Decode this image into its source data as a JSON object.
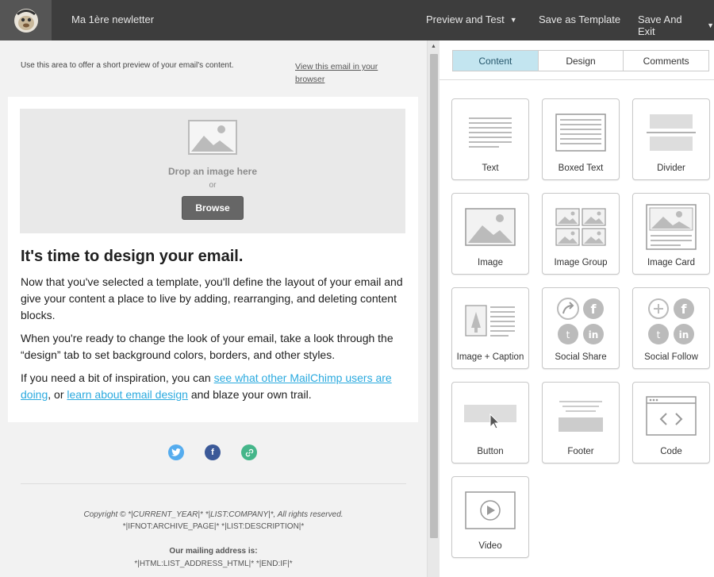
{
  "topbar": {
    "title": "Ma 1ère newletter",
    "preview_label": "Preview and Test",
    "save_template_label": "Save as Template",
    "save_exit_label": "Save And Exit"
  },
  "email": {
    "preheader": "Use this area to offer a short preview of your email's content.",
    "view_in_browser": "View this email in your browser",
    "drop_label": "Drop an image here",
    "drop_or": "or",
    "browse_label": "Browse",
    "heading": "It's time to design your email.",
    "p1": "Now that you've selected a template, you'll define the layout of your email and give your content a place to live by adding, rearranging, and deleting content blocks.",
    "p2": "When you're ready to change the look of your email, take a look through the “design” tab to set background colors, borders, and other styles.",
    "p3_before": "If you need a bit of inspiration, you can ",
    "p3_link1": "see what other MailChimp users are doing",
    "p3_mid": ", or ",
    "p3_link2": "learn about email design",
    "p3_after": " and blaze your own trail.",
    "footer_line1": "Copyright © *|CURRENT_YEAR|* *|LIST:COMPANY|*, All rights reserved.",
    "footer_line2": "*|IFNOT:ARCHIVE_PAGE|* *|LIST:DESCRIPTION|*",
    "footer_line3": "Our mailing address is:",
    "footer_line4": "*|HTML:LIST_ADDRESS_HTML|* *|END:IF|*"
  },
  "social_icons": [
    "twitter-icon",
    "facebook-icon",
    "link-icon"
  ],
  "colors": {
    "topbar": "#3d3d3d",
    "active_tab": "#c3e5f0",
    "link": "#2baadf",
    "twitter": "#55acee",
    "facebook": "#3b5998",
    "website": "#45b68a"
  },
  "panel": {
    "tabs": [
      "Content",
      "Design",
      "Comments"
    ],
    "active_tab": "Content",
    "blocks": [
      {
        "label": "Text",
        "icon": "text-block-icon"
      },
      {
        "label": "Boxed Text",
        "icon": "boxed-text-block-icon"
      },
      {
        "label": "Divider",
        "icon": "divider-block-icon"
      },
      {
        "label": "Image",
        "icon": "image-block-icon"
      },
      {
        "label": "Image Group",
        "icon": "image-group-block-icon"
      },
      {
        "label": "Image Card",
        "icon": "image-card-block-icon"
      },
      {
        "label": "Image + Caption",
        "icon": "image-caption-block-icon"
      },
      {
        "label": "Social Share",
        "icon": "social-share-block-icon"
      },
      {
        "label": "Social Follow",
        "icon": "social-follow-block-icon"
      },
      {
        "label": "Button",
        "icon": "button-block-icon"
      },
      {
        "label": "Footer",
        "icon": "footer-block-icon"
      },
      {
        "label": "Code",
        "icon": "code-block-icon"
      },
      {
        "label": "Video",
        "icon": "video-block-icon"
      }
    ]
  }
}
